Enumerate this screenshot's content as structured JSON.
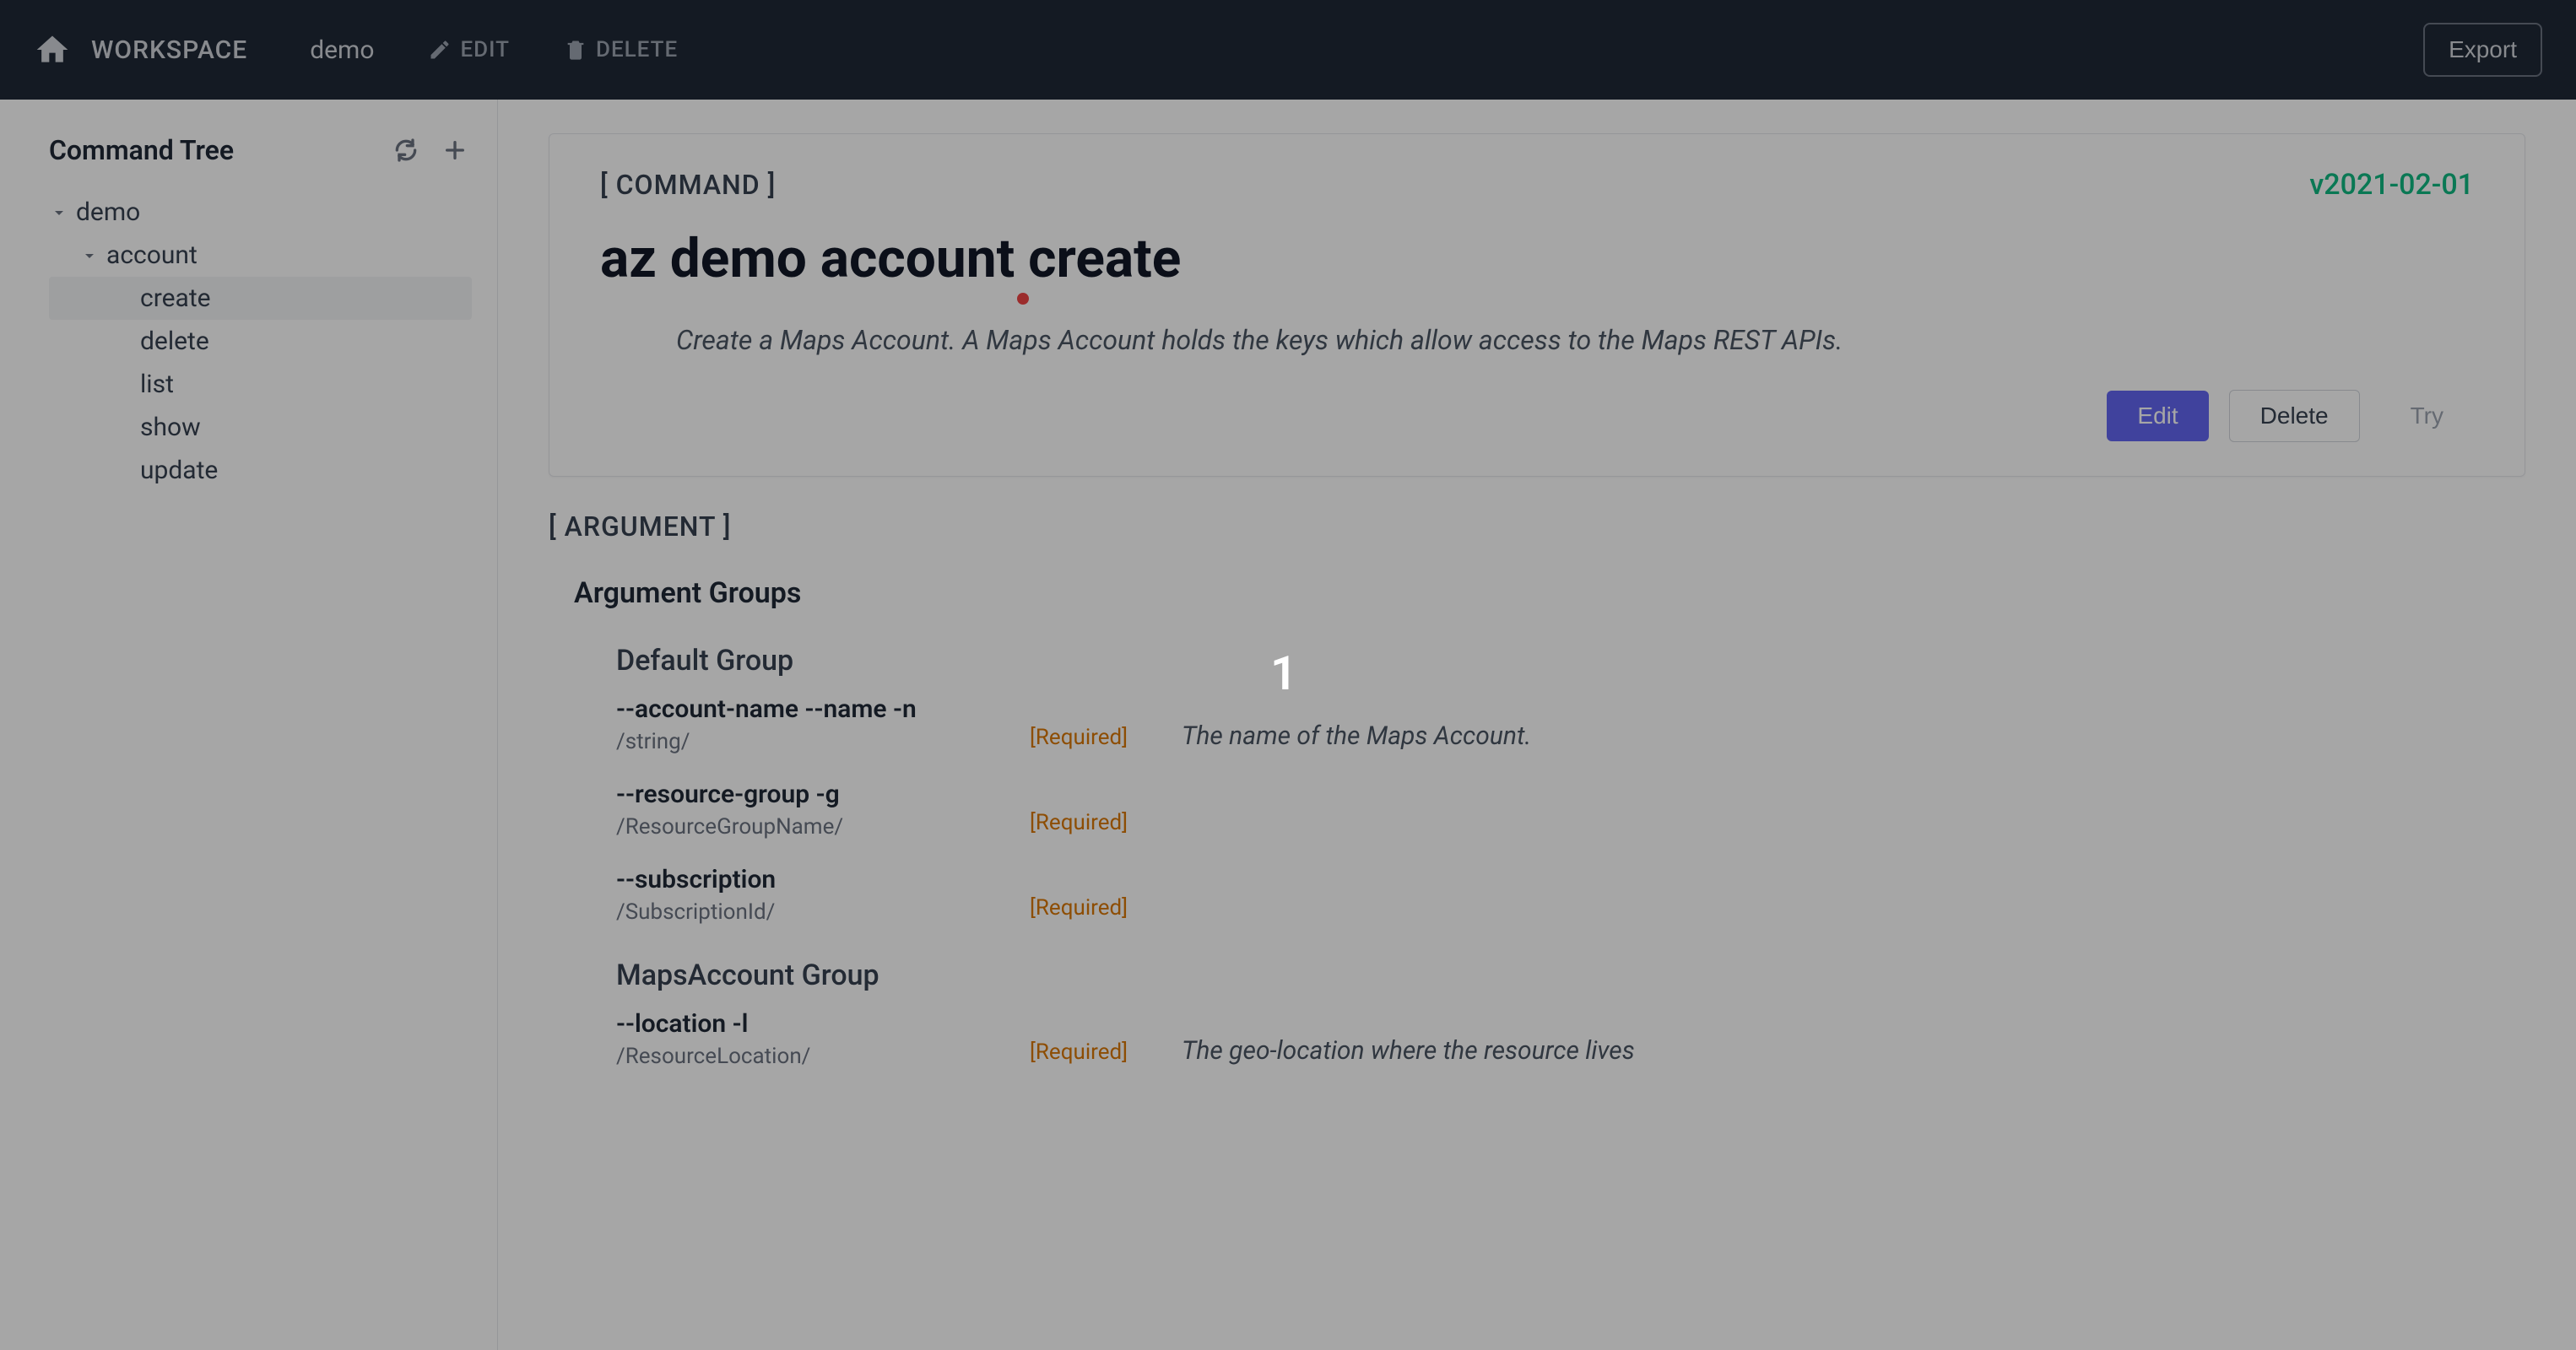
{
  "header": {
    "workspace_label": "WORKSPACE",
    "workspace_name": "demo",
    "edit_label": "EDIT",
    "delete_label": "DELETE",
    "export_label": "Export"
  },
  "sidebar": {
    "title": "Command Tree",
    "tree": {
      "root": "demo",
      "child": "account",
      "leaves": [
        "create",
        "delete",
        "list",
        "show",
        "update"
      ]
    }
  },
  "command": {
    "section_tag": "[ COMMAND ]",
    "version": "v2021-02-01",
    "title": "az demo account create",
    "description": "Create a Maps Account. A Maps Account holds the keys which allow access to the Maps REST APIs.",
    "edit_btn": "Edit",
    "delete_btn": "Delete",
    "try_btn": "Try"
  },
  "argument": {
    "section_tag": "[ ARGUMENT ]",
    "groups_title": "Argument Groups",
    "groups": [
      {
        "title": "Default Group",
        "args": [
          {
            "name": "--account-name --name -n",
            "type": "/string/",
            "required": "[Required]",
            "desc": "The name of the Maps Account."
          },
          {
            "name": "--resource-group -g",
            "type": "/ResourceGroupName/",
            "required": "[Required]",
            "desc": ""
          },
          {
            "name": "--subscription",
            "type": "/SubscriptionId/",
            "required": "[Required]",
            "desc": ""
          }
        ]
      },
      {
        "title": "MapsAccount Group",
        "args": [
          {
            "name": "--location -l",
            "type": "/ResourceLocation/",
            "required": "[Required]",
            "desc": "The geo-location where the resource lives"
          }
        ]
      }
    ]
  },
  "overlay_number": "1"
}
